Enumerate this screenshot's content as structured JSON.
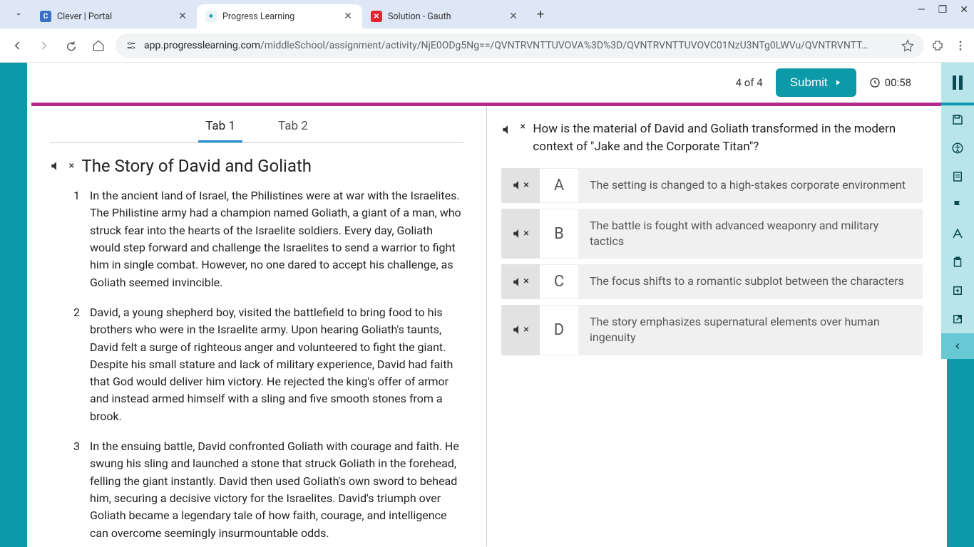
{
  "browser": {
    "tabs": [
      {
        "title": "Clever | Portal",
        "favicon_bg": "#3970c2",
        "favicon_letter": "C",
        "active": false
      },
      {
        "title": "Progress Learning",
        "favicon_bg": "#e9f6f8",
        "favicon_letter": "✦",
        "active": true
      },
      {
        "title": "Solution - Gauth",
        "favicon_bg": "#e0252e",
        "favicon_letter": "✕",
        "active": false
      }
    ],
    "url_domain": "app.progresslearning.com",
    "url_path": "/middleSchool/assignment/activity/NjE0ODg5Ng==/QVNTRVNTTUVOVA%3D%3D/QVNTRVNTTUVOVC01NzU3NTg0LWVu/QVNTRVNTT…"
  },
  "actionbar": {
    "progress": "4 of 4",
    "submit_label": "Submit",
    "timer": "00:58"
  },
  "tabs": {
    "tab1": "Tab 1",
    "tab2": "Tab 2"
  },
  "story": {
    "title": "The Story of David and Goliath",
    "paragraphs": [
      "In the ancient land of Israel, the Philistines were at war with the Israelites. The Philistine army had a champion named Goliath, a giant of a man, who struck fear into the hearts of the Israelite soldiers. Every day, Goliath would step forward and challenge the Israelites to send a warrior to fight him in single combat. However, no one dared to accept his challenge, as Goliath seemed invincible.",
      "David, a young shepherd boy, visited the battlefield to bring food to his brothers who were in the Israelite army. Upon hearing Goliath's taunts, David felt a surge of righteous anger and volunteered to fight the giant. Despite his small stature and lack of military experience, David had faith that God would deliver him victory. He rejected the king's offer of armor and instead armed himself with a sling and five smooth stones from a brook.",
      "In the ensuing battle, David confronted Goliath with courage and faith. He swung his sling and launched a stone that struck Goliath in the forehead, felling the giant instantly. David then used Goliath's own sword to behead him, securing a decisive victory for the Israelites. David's triumph over Goliath became a legendary tale of how faith, courage, and intelligence can overcome seemingly insurmountable odds."
    ]
  },
  "question": {
    "prompt": "How is the material of David and Goliath transformed in the modern context of \"Jake and the Corporate Titan\"?",
    "choices": [
      {
        "letter": "A",
        "text": "The setting is changed to a high-stakes corporate environment"
      },
      {
        "letter": "B",
        "text": "The battle is fought with advanced weaponry and military tactics"
      },
      {
        "letter": "C",
        "text": "The focus shifts to a romantic subplot between the characters"
      },
      {
        "letter": "D",
        "text": "The story emphasizes supernatural elements over human ingenuity"
      }
    ]
  },
  "sidetools": {
    "icons": [
      "save-icon",
      "accessibility-icon",
      "notes-icon",
      "flag-icon",
      "translate-icon",
      "clipboard-icon",
      "add-note-icon",
      "popout-icon"
    ]
  }
}
